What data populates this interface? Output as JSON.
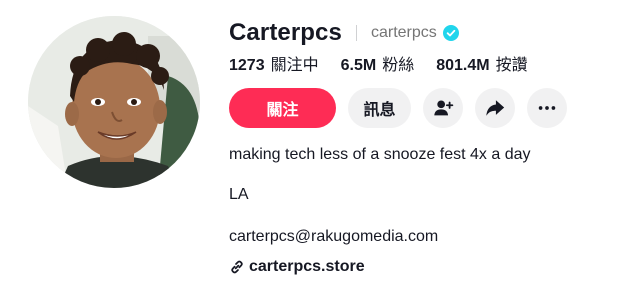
{
  "profile": {
    "display_name": "Carterpcs",
    "username": "carterpcs",
    "verified_icon": "verified-badge-icon"
  },
  "stats": {
    "following_count": "1273",
    "following_label": "關注中",
    "followers_count": "6.5M",
    "followers_label": "粉絲",
    "likes_count": "801.4M",
    "likes_label": "按讚"
  },
  "actions": {
    "follow_label": "關注",
    "message_label": "訊息",
    "add_friend_icon": "add-friend-icon",
    "share_icon": "share-icon",
    "more_icon": "more-icon"
  },
  "bio": {
    "line1": "making tech less of a snooze fest 4x a day",
    "line2": "LA",
    "line3": "carterpcs@rakugomedia.com"
  },
  "link": {
    "icon": "link-icon",
    "text": "carterpcs.store"
  },
  "colors": {
    "accent": "#fe2c55",
    "verified": "#20d5ec",
    "button_bg": "#f1f1f2",
    "text": "#161823",
    "muted": "#757575"
  }
}
